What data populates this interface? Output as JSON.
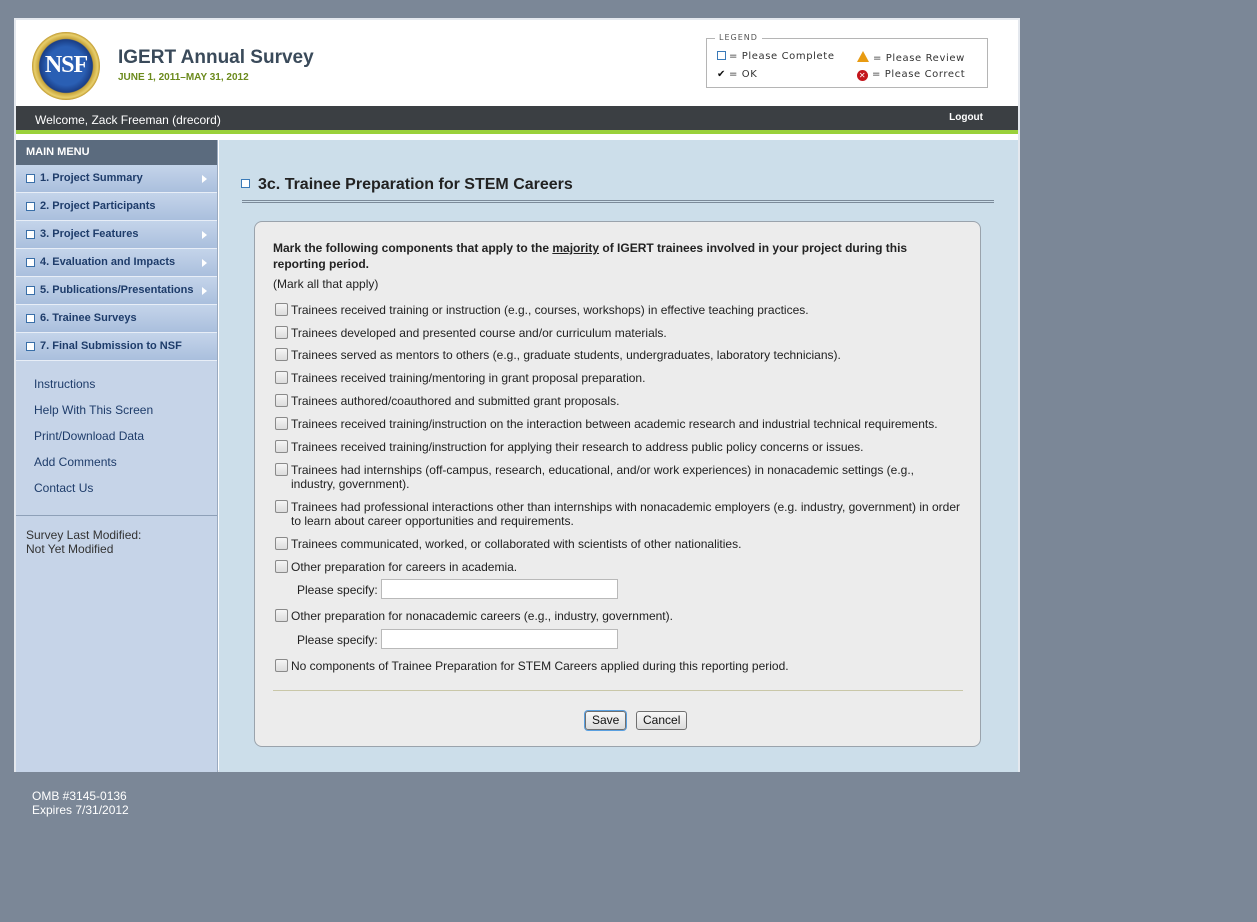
{
  "header": {
    "app_title": "IGERT Annual Survey",
    "dates": "JUNE 1, 2011–MAY 31, 2012",
    "logo_text": "NSF",
    "legend": {
      "title": "LEGEND",
      "please_complete": "= Please Complete",
      "please_review": "= Please Review",
      "ok": "= OK",
      "please_correct": "= Please Correct"
    }
  },
  "topbar": {
    "welcome": "Welcome, Zack Freeman (drecord)",
    "logout": "Logout"
  },
  "sidebar": {
    "menu_title": "MAIN MENU",
    "items": [
      {
        "label": "1. Project Summary",
        "has_arrow": true
      },
      {
        "label": "2. Project Participants",
        "has_arrow": false
      },
      {
        "label": "3. Project Features",
        "has_arrow": true
      },
      {
        "label": "4. Evaluation and Impacts",
        "has_arrow": true
      },
      {
        "label": "5. Publications/Presentations",
        "has_arrow": true
      },
      {
        "label": "6. Trainee Surveys",
        "has_arrow": false
      },
      {
        "label": "7. Final Submission to NSF",
        "has_arrow": false
      }
    ],
    "links": [
      "Instructions",
      "Help With This Screen",
      "Print/Download Data",
      "Add Comments",
      "Contact Us"
    ],
    "modified_label": "Survey Last Modified:",
    "modified_value": "Not Yet Modified"
  },
  "main": {
    "title": "3c. Trainee Preparation for STEM Careers",
    "intro_before": "Mark the following components that apply to the ",
    "intro_emph": "majority",
    "intro_after": " of IGERT trainees involved in your project during this reporting period.",
    "mark_all": "(Mark all that apply)",
    "options": [
      "Trainees received training or instruction (e.g., courses, workshops) in effective teaching practices.",
      "Trainees developed and presented course and/or curriculum materials.",
      "Trainees served as mentors to others (e.g., graduate students, undergraduates, laboratory technicians).",
      "Trainees received training/mentoring in grant proposal preparation.",
      "Trainees authored/coauthored and submitted grant proposals.",
      "Trainees received training/instruction on the interaction between academic research and industrial technical requirements.",
      "Trainees received training/instruction for applying their research to address public policy concerns or issues.",
      "Trainees had internships (off-campus, research, educational, and/or work experiences) in nonacademic settings (e.g., industry, government).",
      "Trainees had professional interactions other than internships with nonacademic employers (e.g. industry, government) in order to learn about career opportunities and requirements.",
      "Trainees communicated, worked, or collaborated with scientists of other nationalities.",
      "Other preparation for careers in academia.",
      "Other preparation for nonacademic careers (e.g., industry, government).",
      "No components of Trainee Preparation for STEM Careers applied during this reporting period."
    ],
    "specify_label": "Please specify:",
    "specify_academia_value": "",
    "specify_nonacademic_value": "",
    "save": "Save",
    "cancel": "Cancel"
  },
  "footer": {
    "omb": "OMB #3145-0136",
    "expires": "Expires 7/31/2012"
  }
}
